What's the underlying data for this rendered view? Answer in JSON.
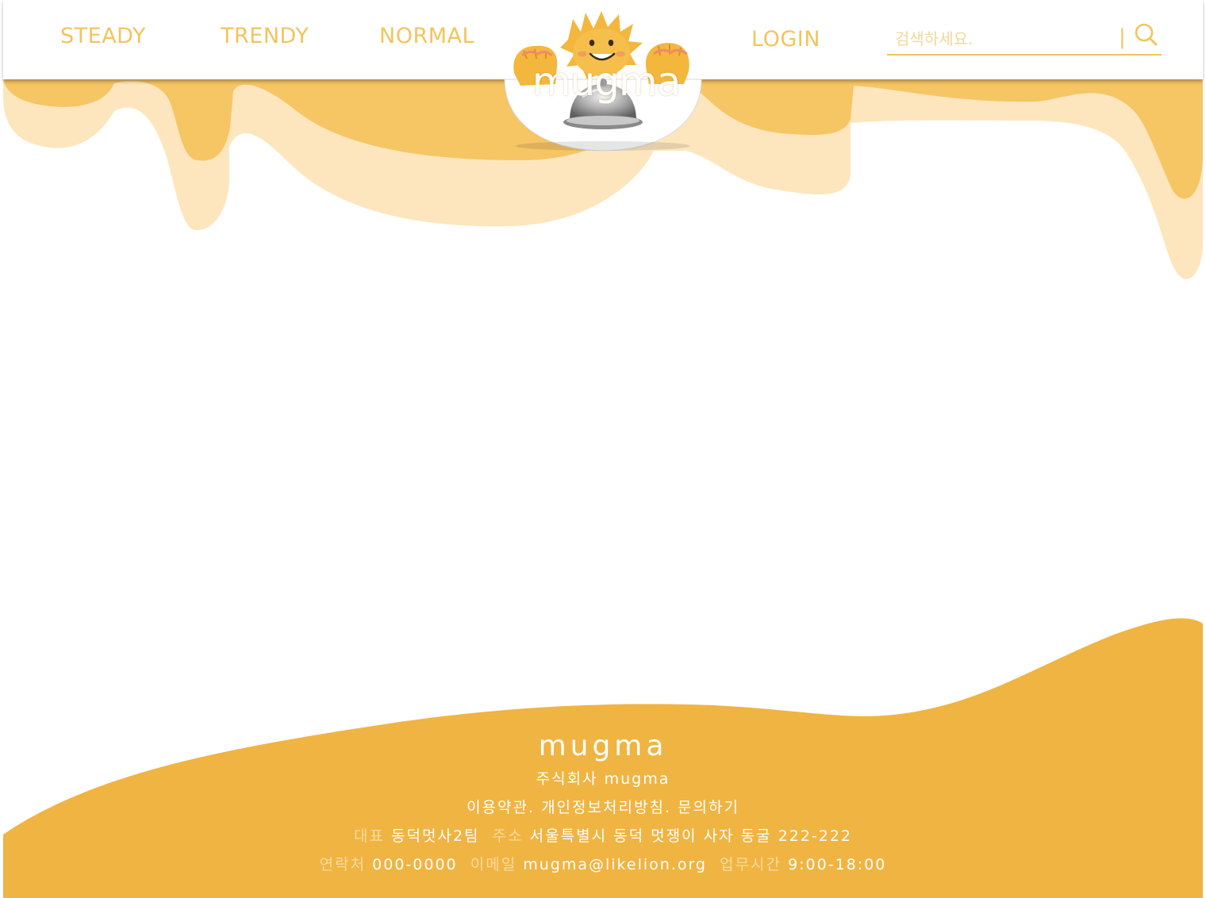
{
  "header": {
    "nav": [
      "STEADY",
      "TRENDY",
      "NORMAL"
    ],
    "login": "LOGIN",
    "logo_text": "mugma",
    "search": {
      "placeholder": "검색하세요.",
      "separator": "|"
    }
  },
  "footer": {
    "brand": "mugma",
    "company": "주식회사 mugma",
    "links": [
      "이용약관.",
      "개인정보처리방침.",
      "문의하기"
    ],
    "ceo_label": "대표",
    "ceo": "동덕멋사2팀",
    "address_label": "주소",
    "address": "서울특별시 동덕 멋쟁이 사자 동굴 222-222",
    "phone_label": "연락처",
    "phone": "000-0000",
    "email_label": "이메일",
    "email": "mugma@likelion.org",
    "hours_label": "업무시간",
    "hours": "9:00-18:00"
  },
  "colors": {
    "accent": "#f3c45c",
    "drip_dark": "#f6c564",
    "drip_light": "#fde6bd",
    "footer": "#f0b442",
    "white": "#ffffff"
  },
  "icons": [
    "search-icon",
    "mascot-icon",
    "cloche-icon"
  ]
}
